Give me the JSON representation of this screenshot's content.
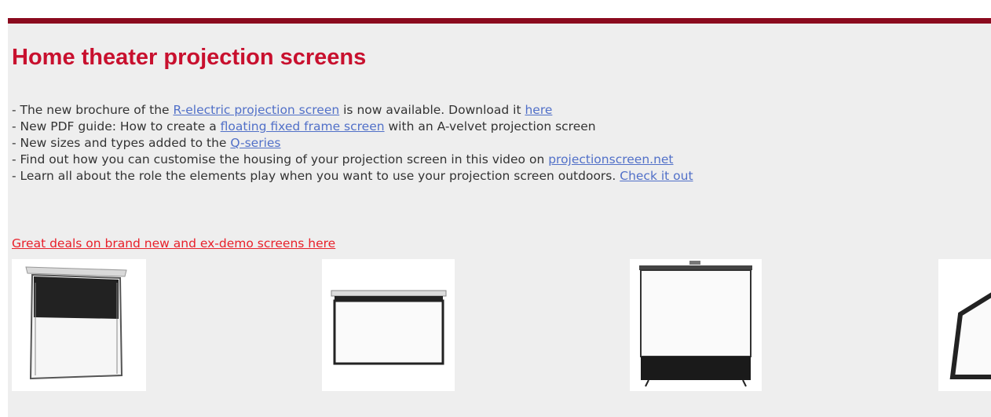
{
  "page": {
    "title": "Home theater projection screens",
    "news": [
      {
        "before": "- The new brochure of the ",
        "link1": "R-electric projection screen",
        "middle": " is now available. Download it ",
        "link2": "here",
        "after": ""
      },
      {
        "before": "- New PDF guide: How to create a ",
        "link1": "floating fixed frame screen",
        "after": " with an A-velvet projection screen"
      },
      {
        "before": "- New sizes and types added to the ",
        "link1": "Q-series",
        "after": ""
      },
      {
        "before": "- Find out how you can customise the housing of your projection screen in this video on ",
        "link1": "projectionscreen.net",
        "after": ""
      },
      {
        "before": "- Learn all about the role the elements play when you want to use your projection screen outdoors. ",
        "link1": "Check it out",
        "after": ""
      }
    ],
    "deals_link": "Great deals on brand new and ex-demo screens here"
  },
  "colors": {
    "top_bar": "#8b0a1e",
    "title": "#c8102e",
    "link": "#5170c8",
    "deals_link": "#e8202a",
    "background": "#eeeeee"
  },
  "thumbnails": [
    {
      "icon": "tab-tensioned-screen-icon"
    },
    {
      "icon": "wall-screen-icon"
    },
    {
      "icon": "portable-floor-screen-icon"
    },
    {
      "icon": "fixed-frame-screen-icon"
    }
  ]
}
